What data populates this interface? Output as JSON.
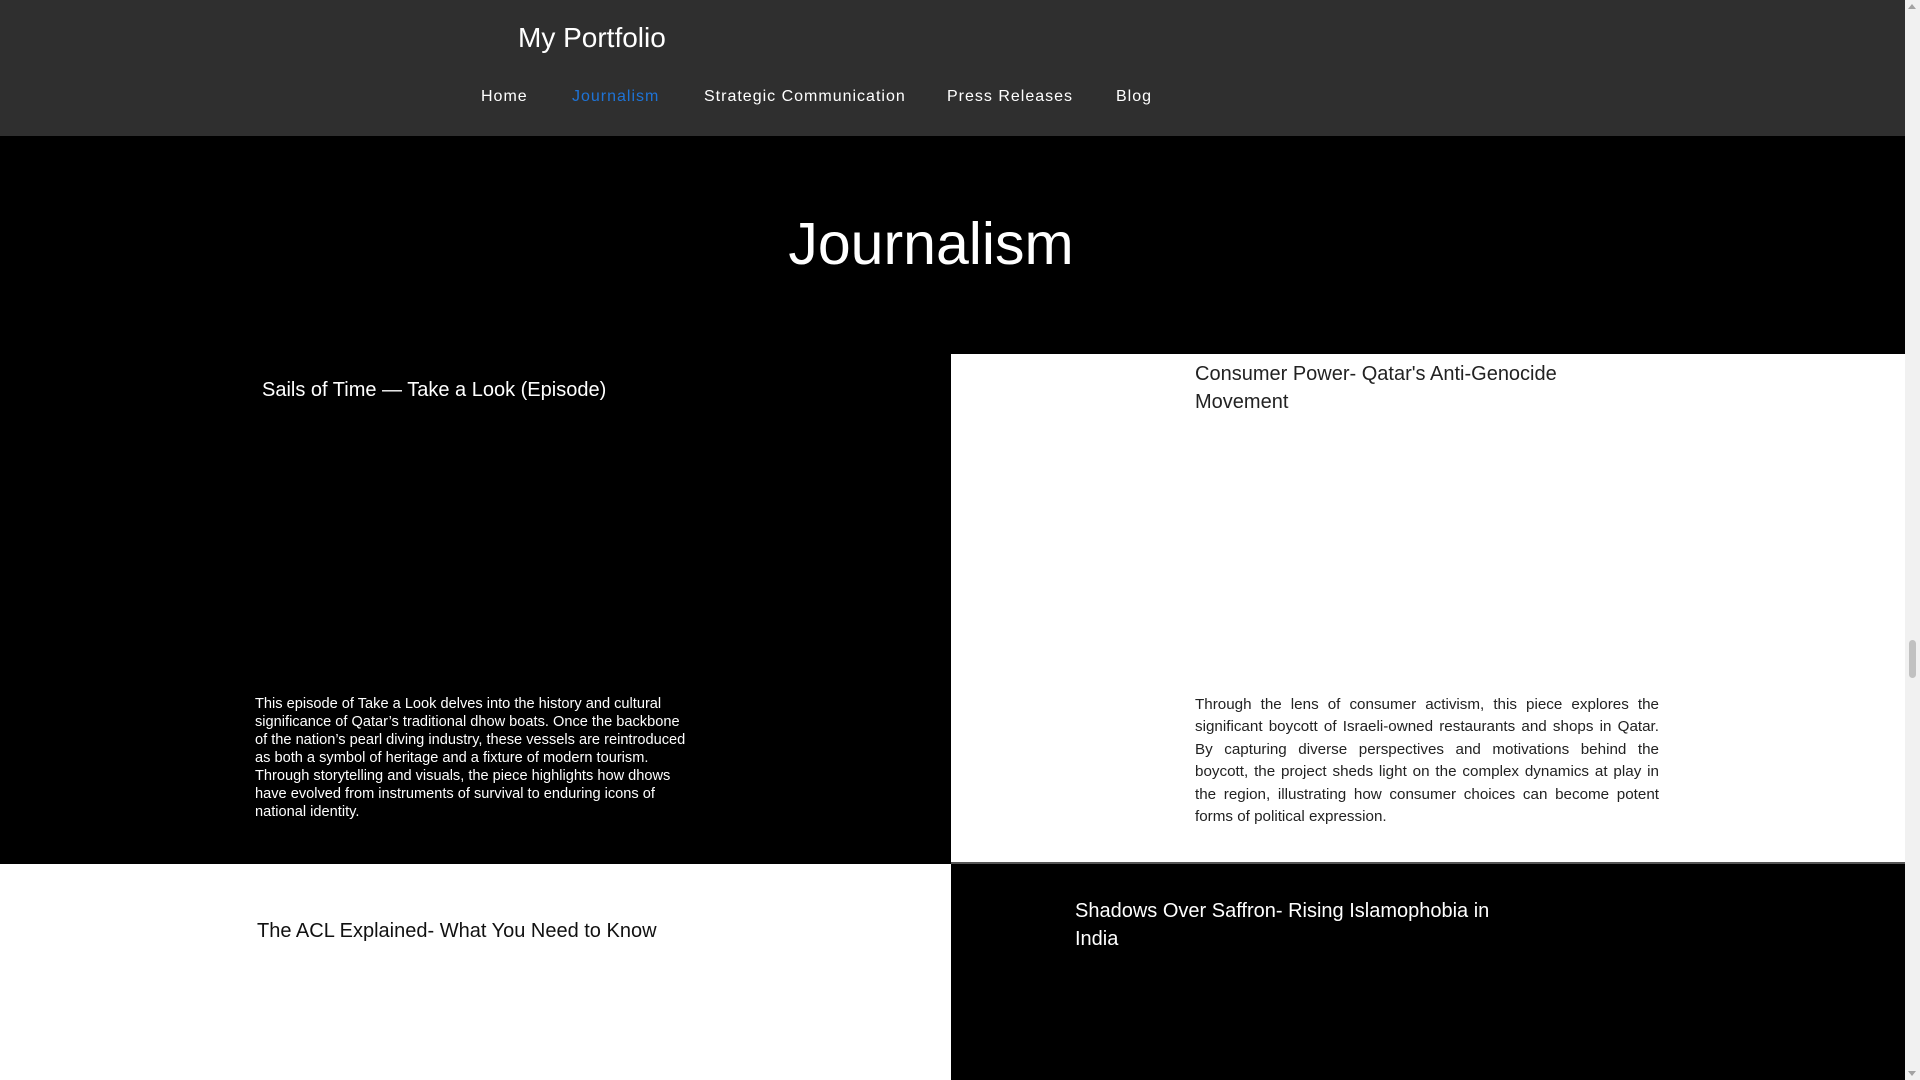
{
  "header": {
    "site_title": "My Portfolio",
    "nav": [
      {
        "label": "Home"
      },
      {
        "label": "Journalism"
      },
      {
        "label": "Strategic Communication"
      },
      {
        "label": "Press Releases"
      },
      {
        "label": "Blog"
      }
    ],
    "active_nav": "Journalism",
    "active_color": "#1e73d6"
  },
  "page": {
    "title": "Journalism"
  },
  "cards": [
    {
      "title": "Sails of Time — Take a Look (Episode)",
      "description": "This episode of Take a Look delves into the history and cultural significance of Qatar’s traditional dhow boats. Once the backbone of the nation’s pearl diving industry, these vessels are reintroduced as both a symbol of heritage and a fixture of modern tourism. Through storytelling and visuals, the piece highlights how dhows have evolved from instruments of survival to enduring icons of national identity."
    },
    {
      "title": "Consumer Power- Qatar's Anti-Genocide Movement",
      "description": "Through the lens of consumer activism, this piece explores the significant boycott of Israeli-owned restaurants and shops in Qatar. By capturing diverse perspectives and motivations behind the boycott, the project sheds light on the complex dynamics at play in the region, illustrating how consumer choices can become potent forms of political expression."
    },
    {
      "title": "The ACL Explained- What You Need to Know"
    },
    {
      "title": "Shadows Over Saffron- Rising Islamophobia in India"
    }
  ]
}
